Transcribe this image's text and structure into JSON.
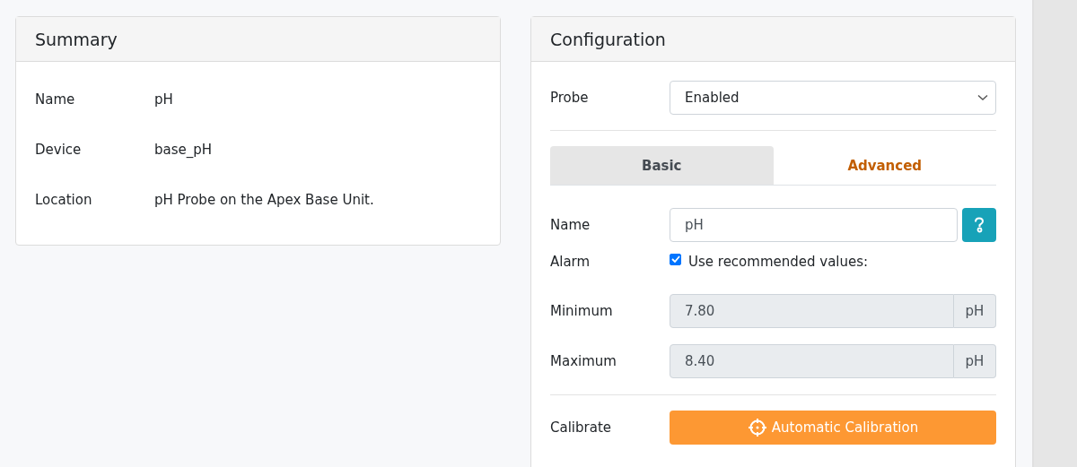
{
  "summary": {
    "title": "Summary",
    "rows": [
      {
        "label": "Name",
        "value": "pH"
      },
      {
        "label": "Device",
        "value": "base_pH"
      },
      {
        "label": "Location",
        "value": "pH Probe on the Apex Base Unit."
      }
    ]
  },
  "configuration": {
    "title": "Configuration",
    "probe": {
      "label": "Probe",
      "value": "Enabled"
    },
    "tabs": [
      {
        "label": "Basic",
        "selected": false
      },
      {
        "label": "Advanced",
        "selected": true
      }
    ],
    "name": {
      "label": "Name",
      "value": "pH"
    },
    "alarm": {
      "label": "Alarm",
      "checkbox_label": "Use recommended values:",
      "checked": true
    },
    "limits": [
      {
        "label": "Minimum",
        "value": "7.80",
        "unit": "pH",
        "disabled": true
      },
      {
        "label": "Maximum",
        "value": "8.40",
        "unit": "pH",
        "disabled": true
      }
    ],
    "calibrate": {
      "label": "Calibrate",
      "button": "Automatic Calibration"
    }
  }
}
